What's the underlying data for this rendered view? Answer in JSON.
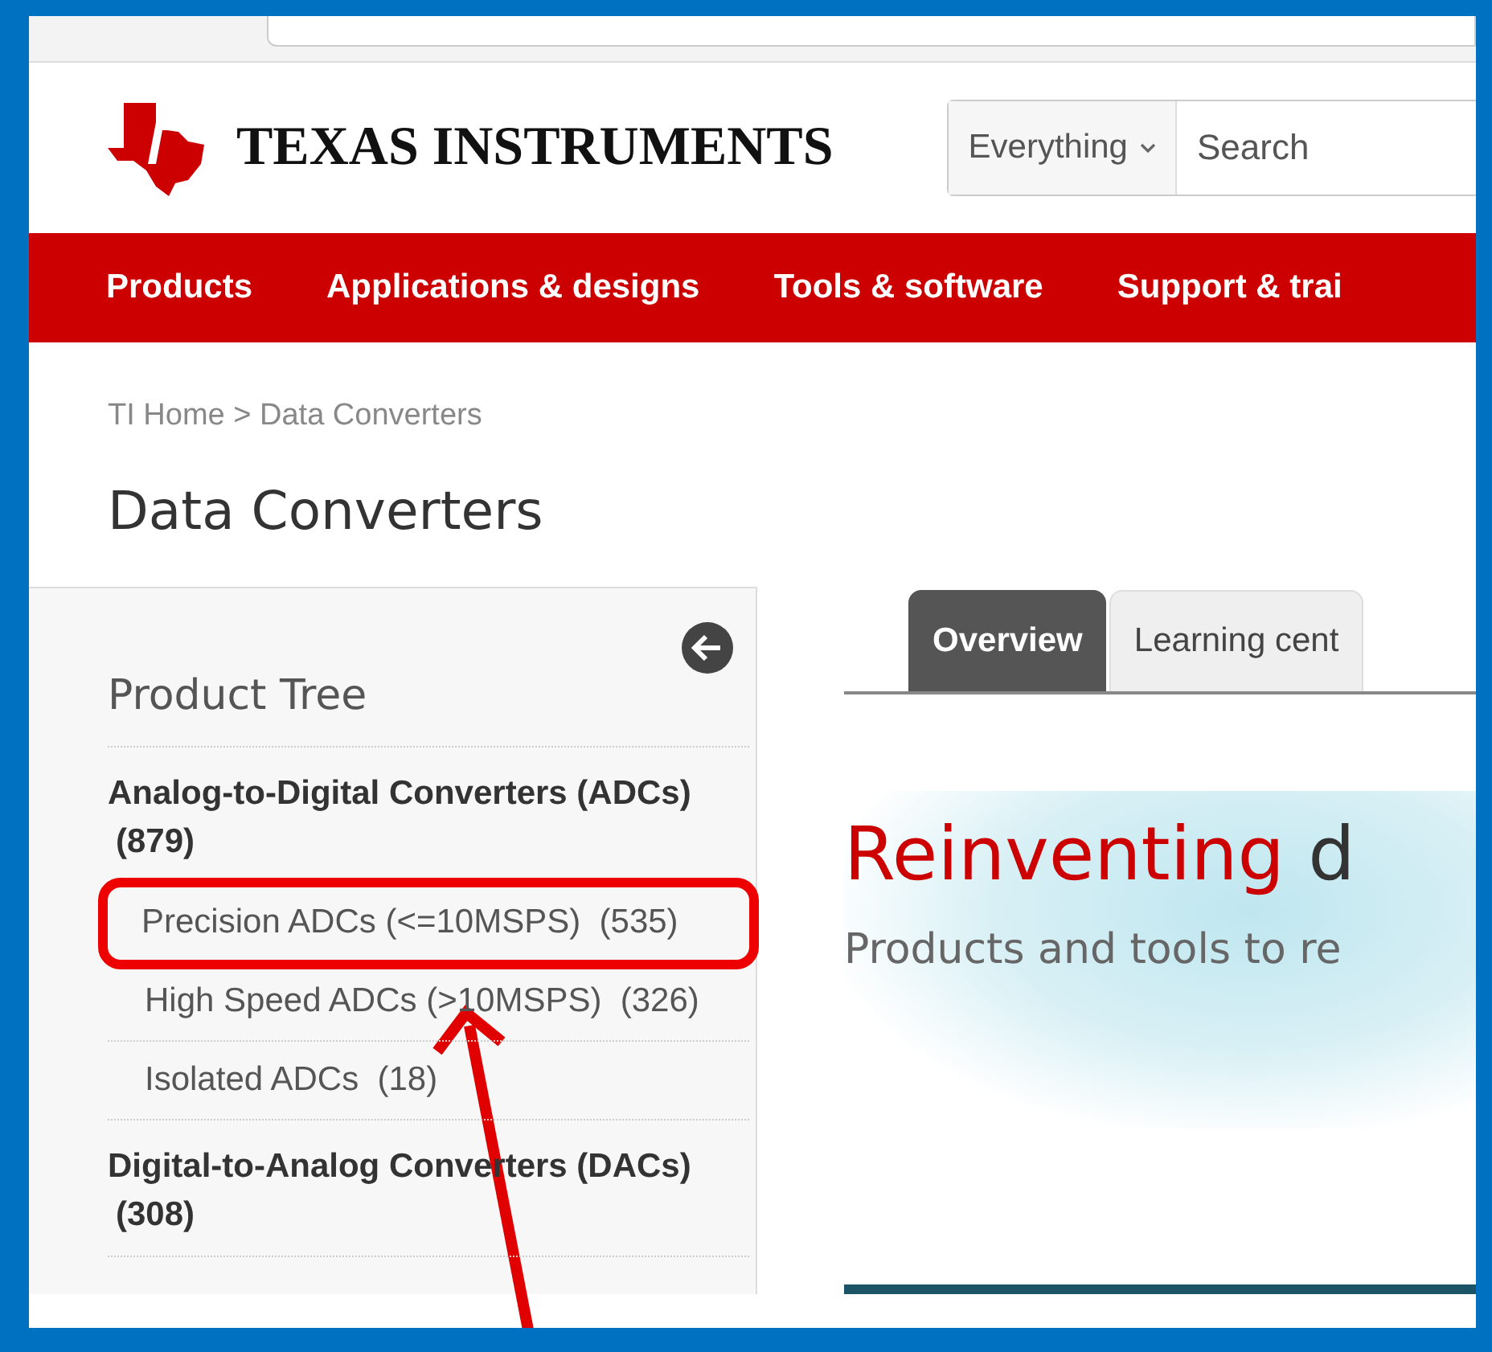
{
  "header": {
    "brand": "TEXAS INSTRUMENTS",
    "search": {
      "scope": "Everything",
      "placeholder": "Search"
    }
  },
  "nav": [
    {
      "label": "Products"
    },
    {
      "label": "Applications & designs"
    },
    {
      "label": "Tools & software"
    },
    {
      "label": "Support & trai"
    }
  ],
  "breadcrumb": "TI Home > Data Converters",
  "title": "Data Converters",
  "sidebar": {
    "title": "Product Tree",
    "tree": [
      {
        "name": "Analog-to-Digital Converters (ADCs)",
        "count": "(879)",
        "highlighted": false,
        "children": [
          {
            "name": "Precision ADCs (<=10MSPS)",
            "count": "(535)",
            "highlighted": true
          },
          {
            "name": "High Speed ADCs (>10MSPS)",
            "count": "(326)",
            "highlighted": false
          },
          {
            "name": "Isolated ADCs",
            "count": "(18)",
            "highlighted": false
          }
        ]
      },
      {
        "name": "Digital-to-Analog Converters (DACs)",
        "count": "(308)",
        "highlighted": false
      }
    ]
  },
  "tabs": [
    {
      "label": "Overview",
      "selected": true
    },
    {
      "label": "Learning cent",
      "selected": false
    }
  ],
  "hero": {
    "heading_accent": "Reinventing",
    "heading_rest": "d",
    "subtitle": "Products and tools to re"
  }
}
